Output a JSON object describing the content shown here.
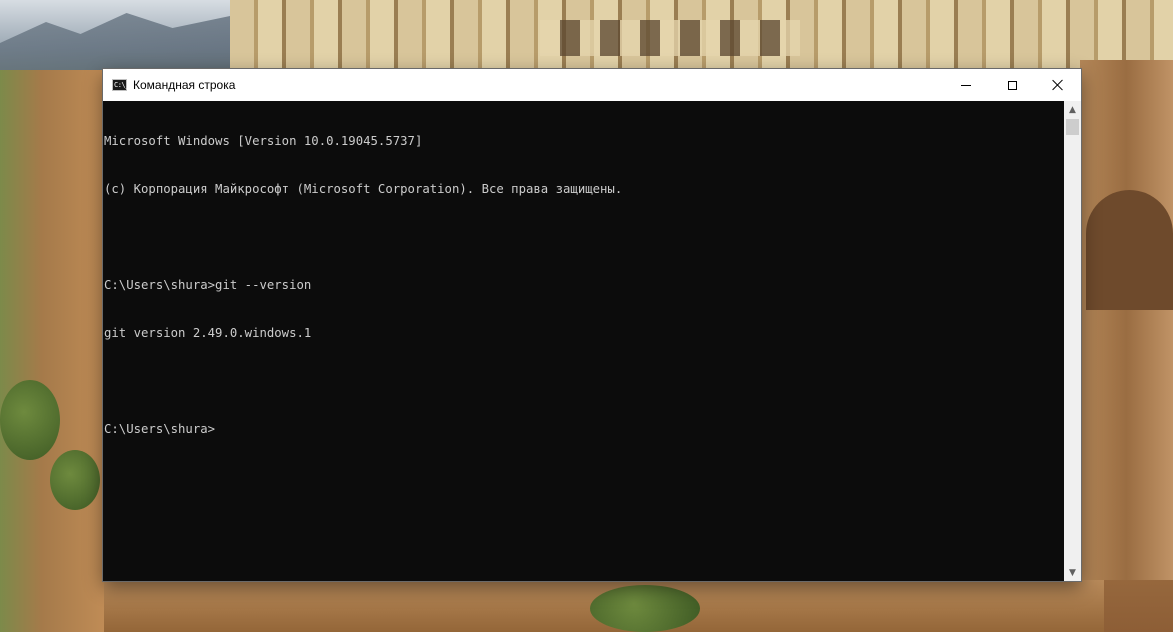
{
  "window": {
    "title": "Командная строка",
    "app_icon_text": "C:\\_",
    "controls": {
      "minimize": "minimize-icon",
      "maximize": "maximize-icon",
      "close": "close-icon"
    }
  },
  "console": {
    "lines": [
      "Microsoft Windows [Version 10.0.19045.5737]",
      "(c) Корпорация Майкрософт (Microsoft Corporation). Все права защищены.",
      "",
      "C:\\Users\\shura>git --version",
      "git version 2.49.0.windows.1",
      "",
      "C:\\Users\\shura>"
    ],
    "colors": {
      "background": "#0c0c0c",
      "foreground": "#cccccc"
    }
  },
  "scrollbar": {
    "up_icon": "▲",
    "down_icon": "▼"
  }
}
